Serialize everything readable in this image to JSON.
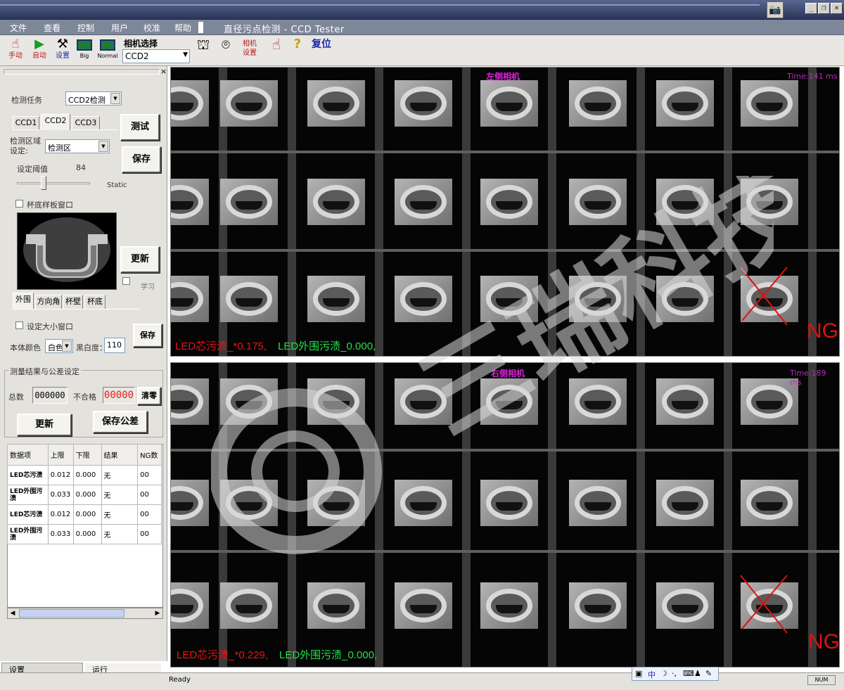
{
  "window": {
    "title": "直径污点检测 - CCD Tester",
    "controls": [
      "minimize",
      "restore",
      "close"
    ]
  },
  "menu": [
    "文件",
    "查看",
    "控制",
    "用户",
    "校准",
    "帮助"
  ],
  "toolbar": {
    "manual": "手动",
    "auto": "自动",
    "settings": "设置",
    "big": "Big",
    "normal": "Normal",
    "camera_select_label": "相机选择",
    "camera_selected": "CCD2",
    "camera_settings": "相机\n设置",
    "help_icon": "?",
    "reset": "复位"
  },
  "left_panel": {
    "task_label": "检测任务",
    "task_value": "CCD2检测",
    "ccd_tabs": [
      "CCD1",
      "CCD2",
      "CCD3"
    ],
    "active_ccd_tab": "CCD2",
    "test_button": "测试",
    "region_label_1": "检测区域",
    "region_label_2": "设定:",
    "region_value": "检测区",
    "save_button": "保存",
    "threshold_label": "设定阈值",
    "threshold_value": "84",
    "threshold_mode": "Static",
    "template_window_label": "杯底样板窗口",
    "update_button": "更新",
    "learn_label": "学习",
    "region_tabs": [
      "外围",
      "方向角",
      "杯壁",
      "杯底"
    ],
    "active_region_tab": "外围",
    "set_size_label": "设定大小窗口",
    "body_color_label": "本体颜色",
    "body_color_value": "白色",
    "whiteness_label": "黑白度：",
    "whiteness_value": "110",
    "save_button_2": "保存",
    "results_group_title": "测量结果与公差设定",
    "total_label": "总数",
    "total_value": "000000",
    "fail_label": "不合格",
    "fail_value": "00000",
    "clear_button": "清零",
    "update_button_2": "更新",
    "save_tolerance_button": "保存公差",
    "grid": {
      "columns": [
        "数据项",
        "上限",
        "下限",
        "结果",
        "NG数"
      ],
      "rows": [
        [
          "LED芯污渍",
          "0.012",
          "0.000",
          "无",
          "00"
        ],
        [
          "LED外围污渍",
          "0.033",
          "0.000",
          "无",
          "00"
        ],
        [
          "LED芯污渍",
          "0.012",
          "0.000",
          "无",
          "00"
        ],
        [
          "LED外围污渍",
          "0.033",
          "0.000",
          "无",
          "00"
        ]
      ]
    },
    "bottom_tabs": [
      "设置",
      "运行"
    ]
  },
  "views": [
    {
      "title": "左侧相机",
      "time": "Time:141 ms",
      "result_red": "LED芯污渍_*0.175,",
      "result_green": "LED外围污渍_0.000,",
      "verdict": "NG"
    },
    {
      "title": "右侧相机",
      "time": "Time:189 ms",
      "result_red": "LED芯污渍_*0.229,",
      "result_green": "LED外围污渍_0.000,",
      "verdict": "NG"
    }
  ],
  "watermark": "三瑞科技",
  "status": {
    "text": "Ready",
    "ime": "中",
    "num": "NUM"
  },
  "colors": {
    "menubar": "#7e8799",
    "view_title": "#e020e0",
    "result_red": "#e81414",
    "result_green": "#22e04a",
    "ng": "#e01010"
  }
}
